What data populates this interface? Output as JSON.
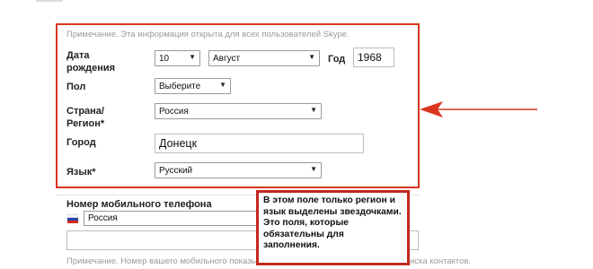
{
  "note_top": "Примечание. Эта информация открыта для всех пользователей Skype.",
  "birth": {
    "label_line1": "Дата",
    "label_line2": "рождения",
    "day": "10",
    "month": "Август",
    "year_label": "Год",
    "year": "1968"
  },
  "gender": {
    "label": "Пол",
    "value": "Выберите"
  },
  "country": {
    "label_line1": "Страна/",
    "label_line2": "Регион*",
    "value": "Россия"
  },
  "city": {
    "label": "Город",
    "value": "Донецк"
  },
  "language": {
    "label": "Язык*",
    "value": "Русский"
  },
  "mobile": {
    "label": "Номер мобильного телефона",
    "country_value": "Россия",
    "number_value": "",
    "note": "Примечание. Номер вашего мобильного показы",
    "note_tail": "иска контактов."
  },
  "callout_text": "В этом поле только регион и язык выделены звездочками. Это поля, которые обязательны для заполнения.",
  "colors": {
    "annotation_red": "#d9361f",
    "callout_border": "#c1271e"
  }
}
